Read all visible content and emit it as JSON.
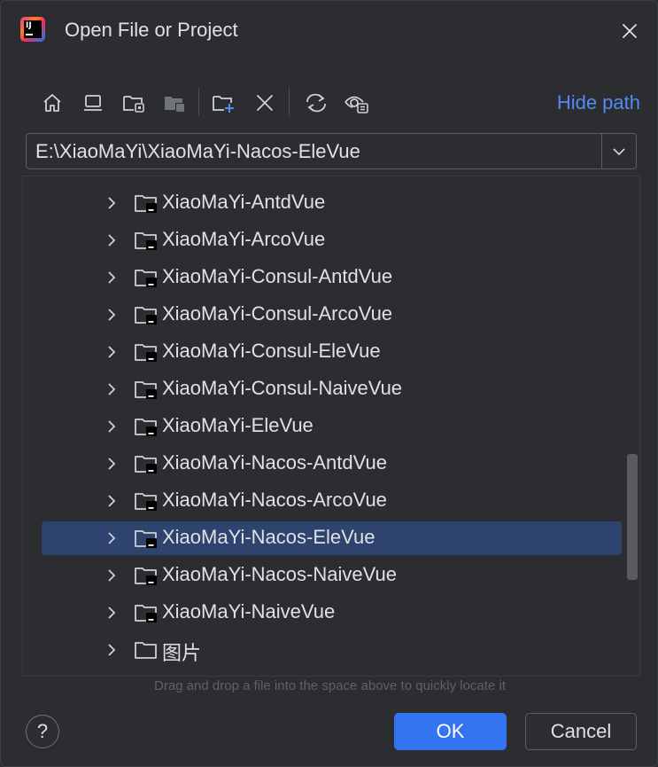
{
  "dialog": {
    "title": "Open File or Project",
    "app_logo_text": "IJ"
  },
  "toolbar": {
    "buttons": [
      {
        "name": "home-icon"
      },
      {
        "name": "desktop-icon"
      },
      {
        "name": "project-directory-icon"
      },
      {
        "name": "module-directory-icon"
      },
      {
        "name": "new-folder-icon"
      },
      {
        "name": "delete-icon"
      },
      {
        "name": "refresh-icon"
      },
      {
        "name": "show-hidden-icon"
      }
    ],
    "hide_path_label": "Hide path"
  },
  "path": {
    "value": "E:\\XiaoMaYi\\XiaoMaYi-Nacos-EleVue"
  },
  "tree": {
    "items": [
      {
        "label": "XiaoMaYi-AntdVue",
        "selected": false,
        "icon": "project-folder-icon"
      },
      {
        "label": "XiaoMaYi-ArcoVue",
        "selected": false,
        "icon": "project-folder-icon"
      },
      {
        "label": "XiaoMaYi-Consul-AntdVue",
        "selected": false,
        "icon": "project-folder-icon"
      },
      {
        "label": "XiaoMaYi-Consul-ArcoVue",
        "selected": false,
        "icon": "project-folder-icon"
      },
      {
        "label": "XiaoMaYi-Consul-EleVue",
        "selected": false,
        "icon": "project-folder-icon"
      },
      {
        "label": "XiaoMaYi-Consul-NaiveVue",
        "selected": false,
        "icon": "project-folder-icon"
      },
      {
        "label": "XiaoMaYi-EleVue",
        "selected": false,
        "icon": "project-folder-icon"
      },
      {
        "label": "XiaoMaYi-Nacos-AntdVue",
        "selected": false,
        "icon": "project-folder-icon"
      },
      {
        "label": "XiaoMaYi-Nacos-ArcoVue",
        "selected": false,
        "icon": "project-folder-icon"
      },
      {
        "label": "XiaoMaYi-Nacos-EleVue",
        "selected": true,
        "icon": "project-folder-icon"
      },
      {
        "label": "XiaoMaYi-Nacos-NaiveVue",
        "selected": false,
        "icon": "project-folder-icon"
      },
      {
        "label": "XiaoMaYi-NaiveVue",
        "selected": false,
        "icon": "project-folder-icon"
      },
      {
        "label": "图片",
        "selected": false,
        "icon": "folder-icon"
      }
    ]
  },
  "hint": "Drag and drop a file into the space above to quickly locate it",
  "buttons": {
    "help": "?",
    "ok": "OK",
    "cancel": "Cancel"
  },
  "colors": {
    "background": "#2b2d30",
    "accent": "#3574f0",
    "link": "#548af7",
    "selection": "#2e436e"
  }
}
